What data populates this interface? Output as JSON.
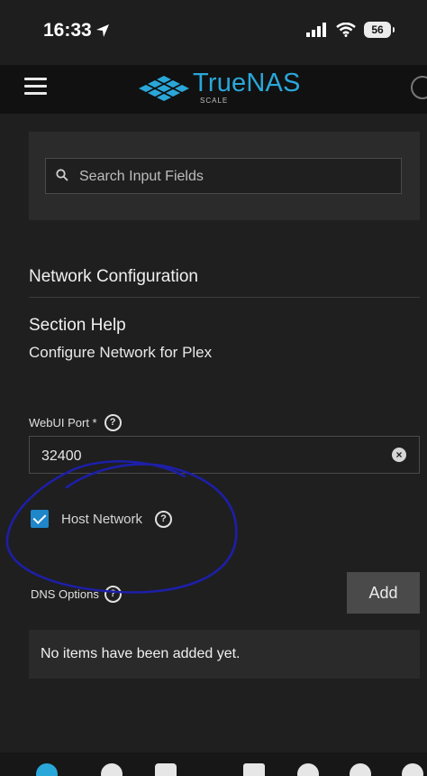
{
  "status_bar": {
    "time": "16:33",
    "battery": "56"
  },
  "header": {
    "brand": "TrueNAS",
    "brand_sub": "SCALE"
  },
  "search": {
    "placeholder": "Search Input Fields"
  },
  "form": {
    "section_title": "Network Configuration",
    "help_title": "Section Help",
    "help_text": "Configure Network for Plex",
    "webui_port_label": "WebUI Port *",
    "webui_port_value": "32400",
    "host_network_label": "Host Network",
    "host_network_checked": true,
    "dns_options_label": "DNS Options",
    "add_button": "Add",
    "empty_text": "No items have been added yet."
  },
  "colors": {
    "accent": "#1e86c9",
    "brand": "#2aa7d9",
    "annotation_ink": "#1d1fa8"
  }
}
